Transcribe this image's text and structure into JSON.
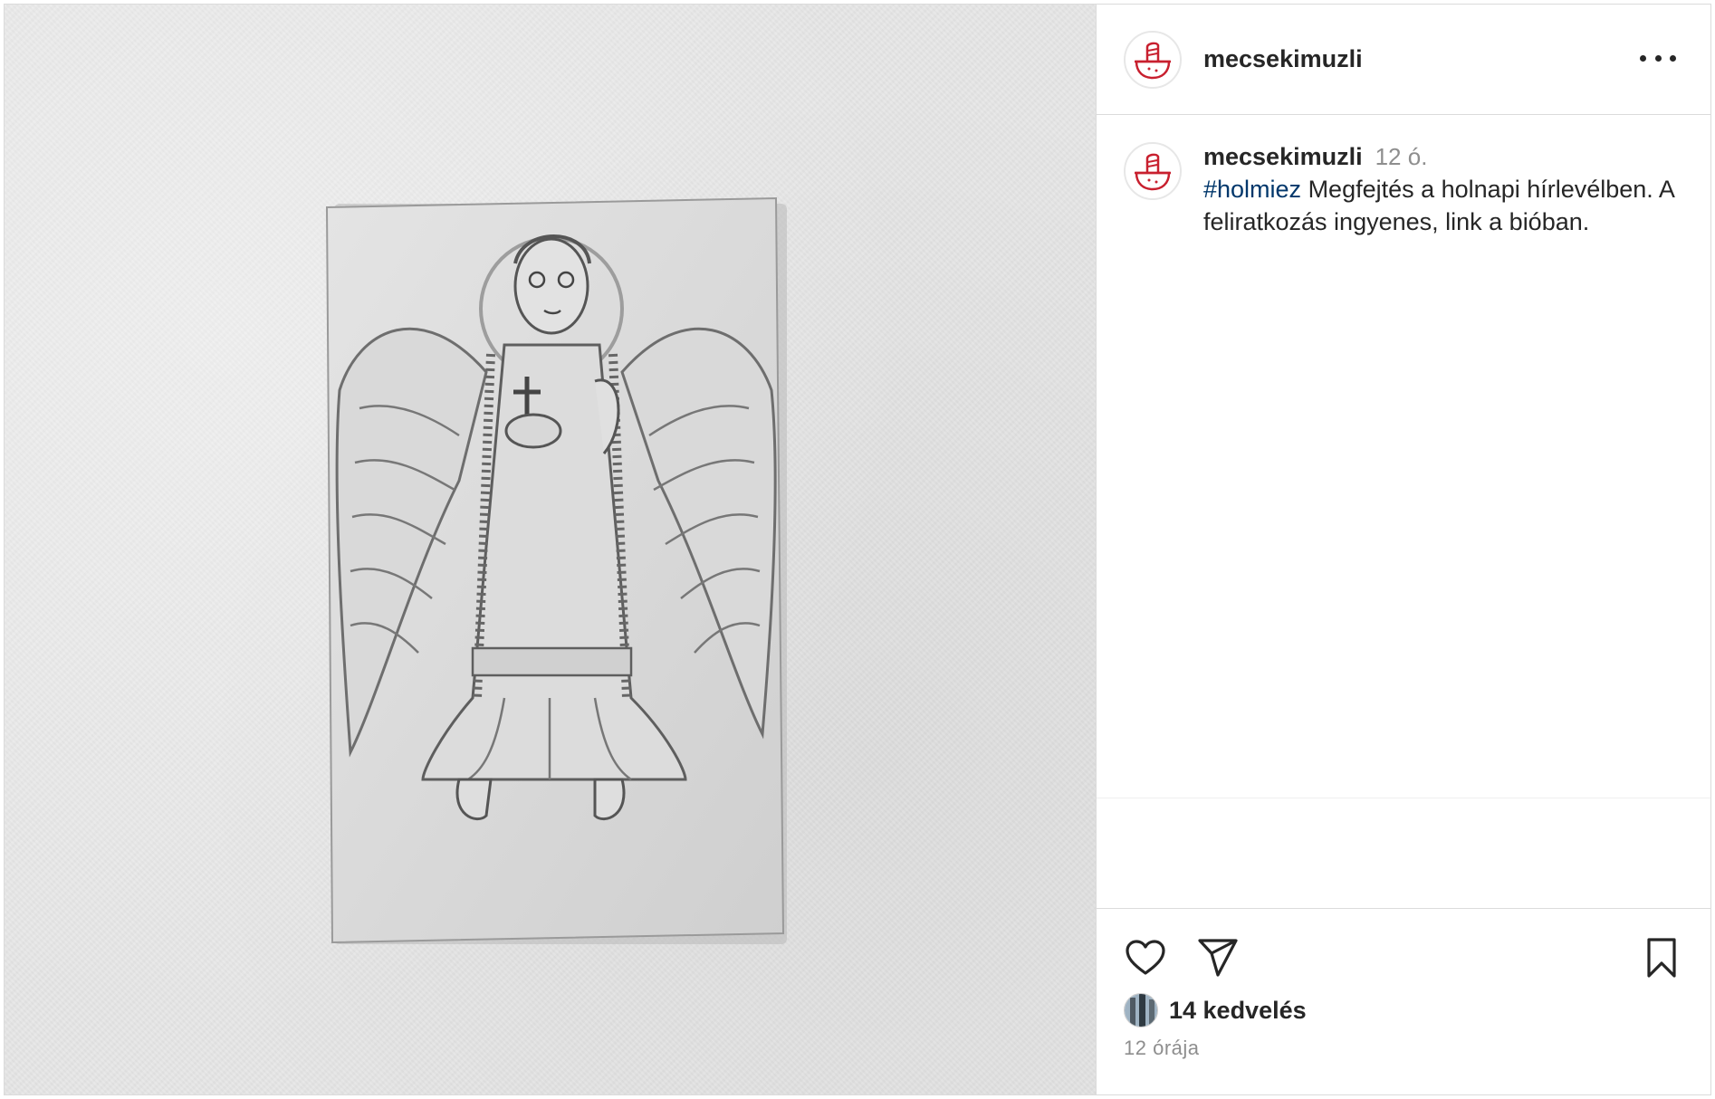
{
  "post": {
    "username": "mecsekimuzli",
    "more_icon": "more-horizontal-icon"
  },
  "caption": {
    "username": "mecsekimuzli",
    "time_ago": "12 ó.",
    "hashtag": "#holmiez",
    "text": " Megfejtés a holnapi hírlevélben. A feliratkozás ingyenes, link a bióban."
  },
  "actions": {
    "like_icon": "heart-icon",
    "share_icon": "paper-plane-icon",
    "save_icon": "bookmark-icon"
  },
  "likes": {
    "text": "14 kedvelés"
  },
  "timestamp": "12 órája",
  "colors": {
    "brand_red": "#c8202f",
    "hashtag": "#00376b",
    "muted": "#8e8e8e",
    "border": "#dbdbdb"
  }
}
